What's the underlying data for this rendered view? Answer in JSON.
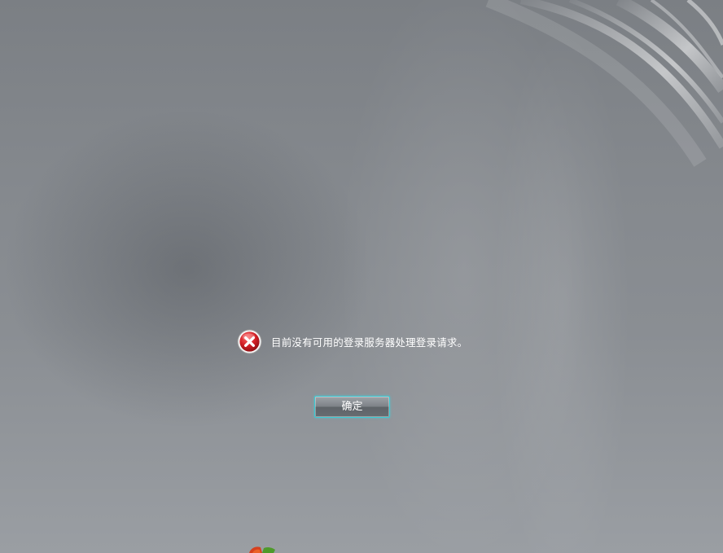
{
  "dialog": {
    "icon": "error-icon",
    "message": "目前没有可用的登录服务器处理登录请求。",
    "ok_button_label": "确定"
  },
  "colors": {
    "background": "#85898e",
    "text": "#ffffff",
    "button_focus_border": "#3bc9d3",
    "error_red": "#c4161c"
  }
}
